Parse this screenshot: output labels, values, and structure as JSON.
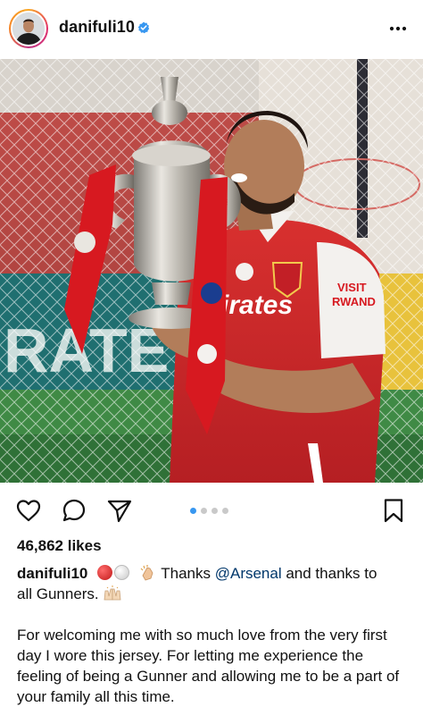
{
  "post": {
    "username": "danifuli10",
    "likes": "46,862 likes",
    "carousel": {
      "count": 4,
      "active_index": 0
    },
    "caption": {
      "username": "danifuli10",
      "line1_text": " Thanks ",
      "mention": "@Arsenal",
      "line1_tail": " and thanks to",
      "line2_text": "all Gunners.",
      "paragraph": "For welcoming me with so much love from the very first day I wore this jersey. For letting me experience the feeling of being a Gunner and allowing me to be a part of your family all this time."
    }
  },
  "icons": {
    "verified": "verified-badge-icon",
    "more": "more-options-icon",
    "like": "heart-icon",
    "comment": "comment-icon",
    "share": "send-icon",
    "save": "bookmark-icon"
  },
  "colors": {
    "accent_blue": "#3897f0",
    "mention": "#00376b",
    "arsenal_red": "#d71920"
  }
}
